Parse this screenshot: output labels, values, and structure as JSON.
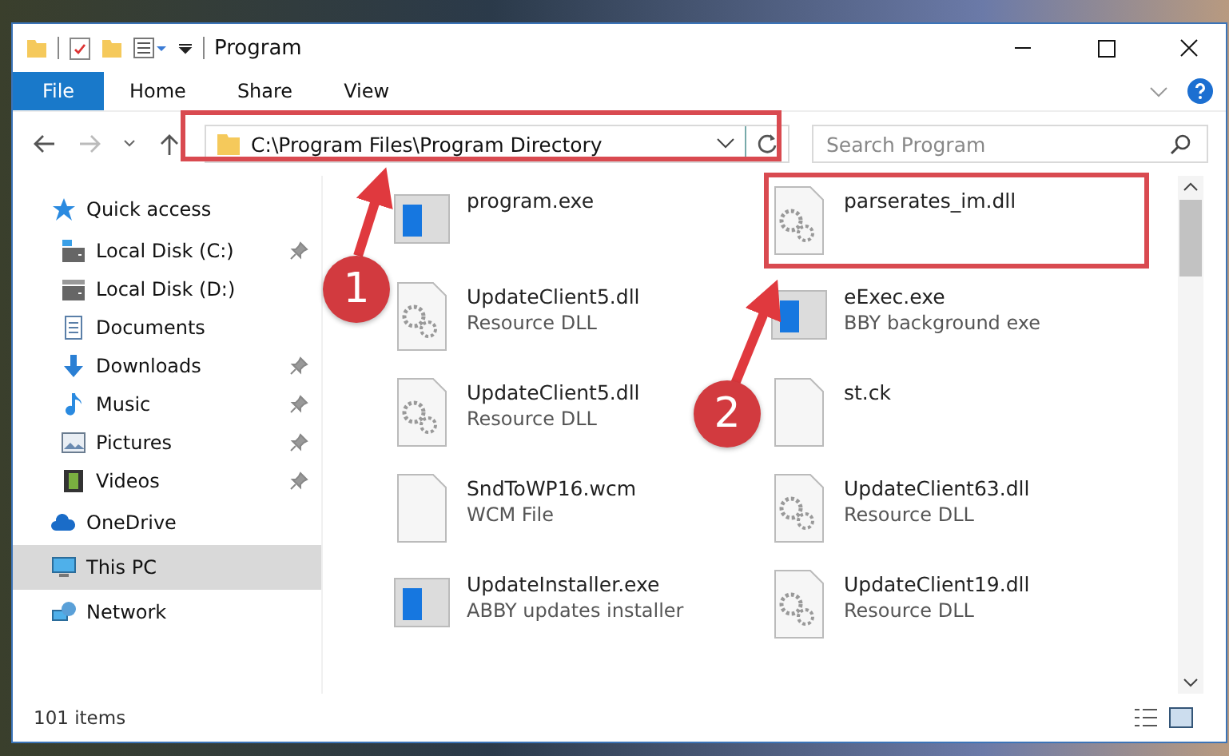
{
  "window": {
    "title": "Program"
  },
  "ribbon": {
    "tabs": [
      {
        "label": "File",
        "kind": "file",
        "selected": false
      },
      {
        "label": "Home",
        "kind": "tab",
        "selected": false
      },
      {
        "label": "Share",
        "kind": "tab",
        "selected": false
      },
      {
        "label": "View",
        "kind": "tab",
        "selected": false
      }
    ]
  },
  "address": {
    "path": "C:\\Program Files\\Program Directory"
  },
  "search": {
    "placeholder": "Search Program"
  },
  "sidebar": {
    "items": [
      {
        "label": "Quick access",
        "kind": "quick",
        "selected": false,
        "children": [
          {
            "label": "Local Disk (C:)",
            "kind": "drive-c",
            "pinned": true,
            "selected": false
          },
          {
            "label": "Local Disk (D:)",
            "kind": "drive",
            "pinned": false,
            "selected": false
          },
          {
            "label": "Documents",
            "kind": "documents",
            "pinned": false,
            "selected": false
          },
          {
            "label": "Downloads",
            "kind": "downloads",
            "pinned": true,
            "selected": false
          },
          {
            "label": "Music",
            "kind": "music",
            "pinned": true,
            "selected": false
          },
          {
            "label": "Pictures",
            "kind": "pictures",
            "pinned": true,
            "selected": false
          },
          {
            "label": "Videos",
            "kind": "videos",
            "pinned": true,
            "selected": false
          }
        ]
      },
      {
        "label": "OneDrive",
        "kind": "cloud",
        "selected": false
      },
      {
        "label": "This PC",
        "kind": "pc",
        "selected": true
      },
      {
        "label": "Network",
        "kind": "network",
        "selected": false
      }
    ]
  },
  "files": [
    {
      "name": "program.exe",
      "kind": "app"
    },
    {
      "name": "parserates_im.dll",
      "kind": "gear"
    },
    {
      "name": "UpdateClient5.dll",
      "type": "Resource DLL",
      "kind": "dll"
    },
    {
      "name": "eExec.exe",
      "type": "BBY background exe",
      "kind": "window"
    },
    {
      "name": "UpdateClient5.dll",
      "type": "Resource DLL",
      "kind": "dll"
    },
    {
      "name": "st.ck",
      "kind": "blank"
    },
    {
      "name": "SndToWP16.wcm",
      "type": "WCM File",
      "kind": "blank"
    },
    {
      "name": "UpdateClient63.dll",
      "type": "Resource DLL",
      "kind": "dll"
    },
    {
      "name": "UpdateInstaller.exe",
      "type": "ABBY updates installer",
      "kind": "window"
    },
    {
      "name": "UpdateClient19.dll",
      "type": "Resource DLL",
      "kind": "dll"
    }
  ],
  "status_bar": {
    "count": "101 items"
  },
  "annotations": [
    {
      "number": "1"
    },
    {
      "number": "2"
    }
  ]
}
